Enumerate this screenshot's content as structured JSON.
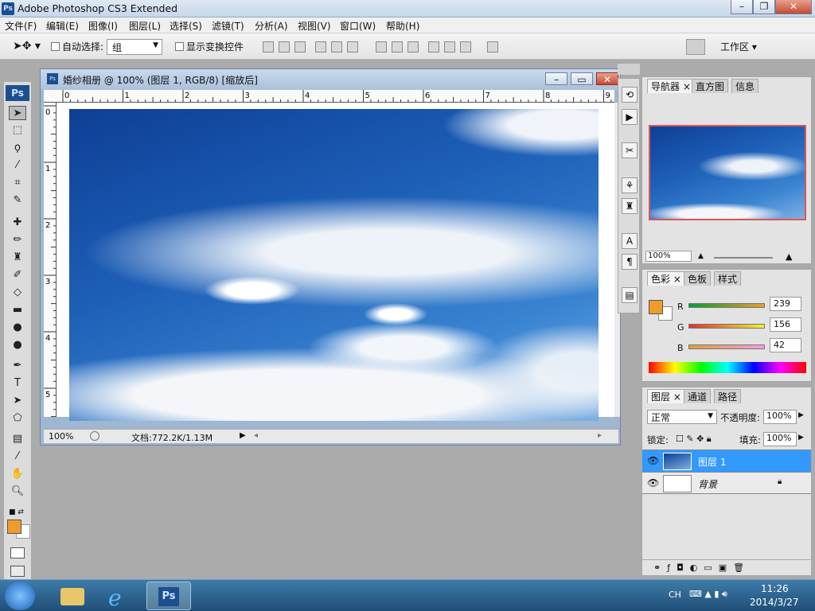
{
  "window": {
    "title": "Adobe Photoshop CS3 Extended",
    "min": "▭",
    "max": "▢",
    "close": "✕"
  },
  "menu": [
    "文件(F)",
    "编辑(E)",
    "图像(I)",
    "图层(L)",
    "选择(S)",
    "滤镜(T)",
    "分析(A)",
    "视图(V)",
    "窗口(W)",
    "帮助(H)"
  ],
  "options": {
    "auto_select_label": "自动选择:",
    "auto_select_value": "组",
    "show_transform_label": "显示变换控件",
    "workspace": "工作区"
  },
  "document": {
    "title": "婚纱相册 @ 100% (图层 1, RGB/8) [缩放后]",
    "zoom": "100%",
    "doc_info": "文档:772.2K/1.13M",
    "ruler_h": [
      "0",
      "1",
      "2",
      "3",
      "4",
      "5",
      "6",
      "7",
      "8",
      "9"
    ],
    "ruler_v": [
      "0",
      "1",
      "2",
      "3",
      "4",
      "5"
    ]
  },
  "navigator": {
    "tabs": [
      "导航器",
      "直方图",
      "信息"
    ],
    "zoom": "100%"
  },
  "color": {
    "tabs": [
      "色彩",
      "色板",
      "样式"
    ],
    "r_label": "R",
    "g_label": "G",
    "b_label": "B",
    "r": "239",
    "g": "156",
    "b": "42",
    "fg": "#ef9c2a"
  },
  "layers": {
    "tabs": [
      "图层",
      "通道",
      "路径"
    ],
    "blend": "正常",
    "opacity_label": "不透明度:",
    "opacity": "100%",
    "lock_label": "锁定:",
    "fill_label": "填充:",
    "fill": "100%",
    "items": [
      {
        "name": "图层 1",
        "selected": true
      },
      {
        "name": "背景",
        "selected": false
      }
    ]
  },
  "taskbar": {
    "time": "11:26",
    "date": "2014/3/27",
    "lang": "CH"
  },
  "colors": {
    "accent": "#3399ff",
    "fg_swatch": "#ef9c2a"
  }
}
